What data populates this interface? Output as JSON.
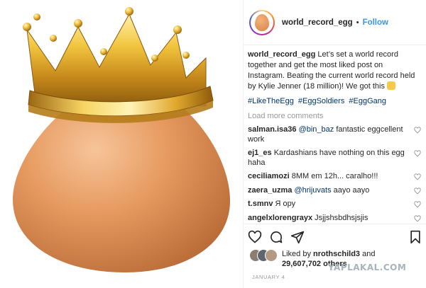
{
  "header": {
    "username": "world_record_egg",
    "dot": "•",
    "follow_label": "Follow"
  },
  "caption": {
    "username": "world_record_egg",
    "text": "Let’s set a world record together and get the most liked post on Instagram. Beating the current world record held by Kylie Jenner (18 million)! We got this"
  },
  "hashtags": [
    "#LikeTheEgg",
    "#EggSoldiers",
    "#EggGang"
  ],
  "load_more": "Load more comments",
  "comments": [
    {
      "username": "salman.isa36",
      "mention": "@bin_baz",
      "text": "fantastic eggcellent work"
    },
    {
      "username": "ej1_es",
      "text": "Kardashians have nothing on this egg haha"
    },
    {
      "username": "ceciliamozi",
      "text": "8MM em 12h... caralho!!!"
    },
    {
      "username": "zaera_uzma",
      "mention": "@hrijuvats",
      "text": "aayo aayo"
    },
    {
      "username": "t.smnv",
      "text": "Я ору"
    },
    {
      "username": "angelxlorengrayx",
      "text": "Jsjjshsbdhsjsjis"
    }
  ],
  "likes": {
    "prefix": "Liked by",
    "user": "nrothschild3",
    "middle": "and",
    "count": "29,607,702 others"
  },
  "date": "JANUARY 4",
  "watermark": "YAPLAKAL.COM",
  "icons": {
    "like": "heart-icon",
    "comment": "comment-icon",
    "share": "share-icon",
    "save": "bookmark-icon"
  },
  "colors": {
    "link": "#3897f0",
    "hashtag": "#003569",
    "muted": "#999999",
    "egg": "#e2925a",
    "crown": "#d9a520"
  }
}
